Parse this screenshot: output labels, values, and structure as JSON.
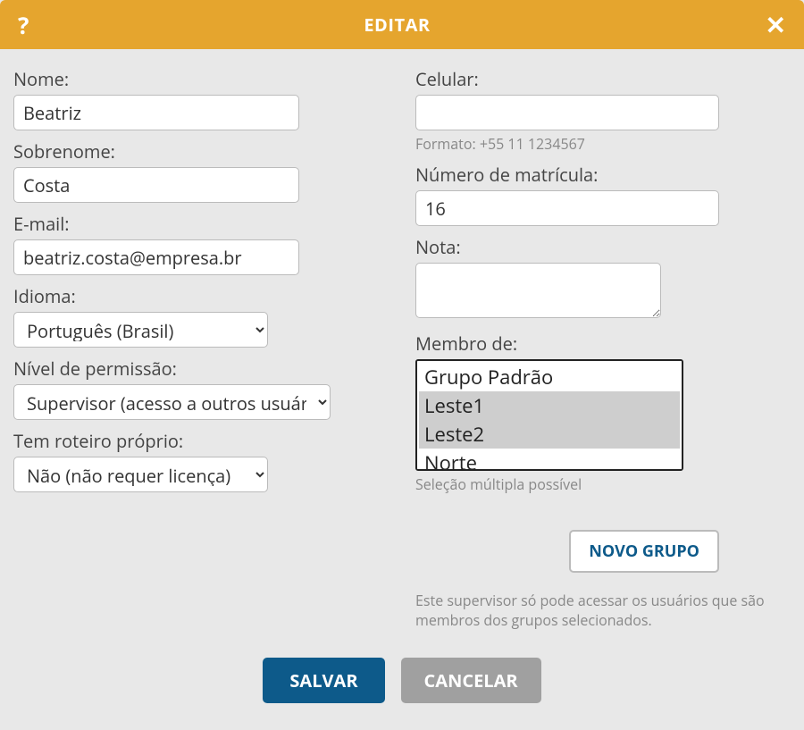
{
  "header": {
    "title": "EDITAR",
    "help_icon": "?",
    "close_icon": "✕"
  },
  "left": {
    "nome_label": "Nome:",
    "nome_value": "Beatriz",
    "sobrenome_label": "Sobrenome:",
    "sobrenome_value": "Costa",
    "email_label": "E-mail:",
    "email_value": "beatriz.costa@empresa.br",
    "idioma_label": "Idioma:",
    "idioma_selected": "Português (Brasil)",
    "permissao_label": "Nível de permissão:",
    "permissao_selected": "Supervisor (acesso a outros usuários)",
    "roteiro_label": "Tem roteiro próprio:",
    "roteiro_selected": "Não (não requer licença)"
  },
  "right": {
    "celular_label": "Celular:",
    "celular_value": "",
    "celular_hint": "Formato: +55 11 1234567",
    "matricula_label": "Número de matrícula:",
    "matricula_value": "16",
    "nota_label": "Nota:",
    "nota_value": "",
    "membro_label": "Membro de:",
    "groups": [
      "Grupo Padrão",
      "Leste1",
      "Leste2",
      "Norte"
    ],
    "groups_selected": [
      "Leste1",
      "Leste2"
    ],
    "membro_hint": "Seleção múltipla possível",
    "novo_grupo_label": "NOVO GRUPO",
    "supervisor_note": "Este supervisor só pode acessar os usuários que são membros dos grupos selecionados."
  },
  "footer": {
    "salvar_label": "SALVAR",
    "cancelar_label": "CANCELAR"
  }
}
